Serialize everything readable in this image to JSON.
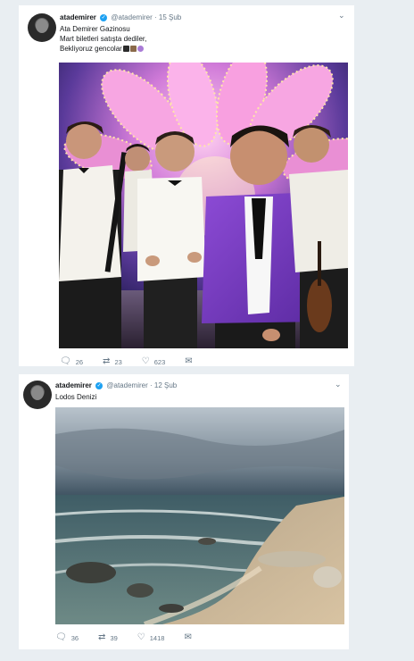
{
  "tweets": [
    {
      "name": "atademirer",
      "handle": "@atademirer",
      "date": "15 Şub",
      "lines": [
        "Ata Demirer Gazinosu",
        "Mart biletleri satışta dediler,",
        "Bekliyoruz gencolar"
      ],
      "emoji_icons": [
        "clarinet-emoji",
        "violin-emoji",
        "hearts-emoji"
      ],
      "replies": "26",
      "retweets": "23",
      "likes": "623"
    },
    {
      "name": "atademirer",
      "handle": "@atademirer",
      "date": "12 Şub",
      "lines": [
        "Lodos Denizi"
      ],
      "replies": "36",
      "retweets": "39",
      "likes": "1418"
    }
  ],
  "ui": {
    "dot": "·",
    "verified_glyph": "✓",
    "chevron": "⌄",
    "reply_icon": "reply-icon",
    "retweet_icon": "retweet-icon",
    "like_icon": "heart-icon",
    "dm_icon": "envelope-icon",
    "accent": "#1da1f2"
  }
}
